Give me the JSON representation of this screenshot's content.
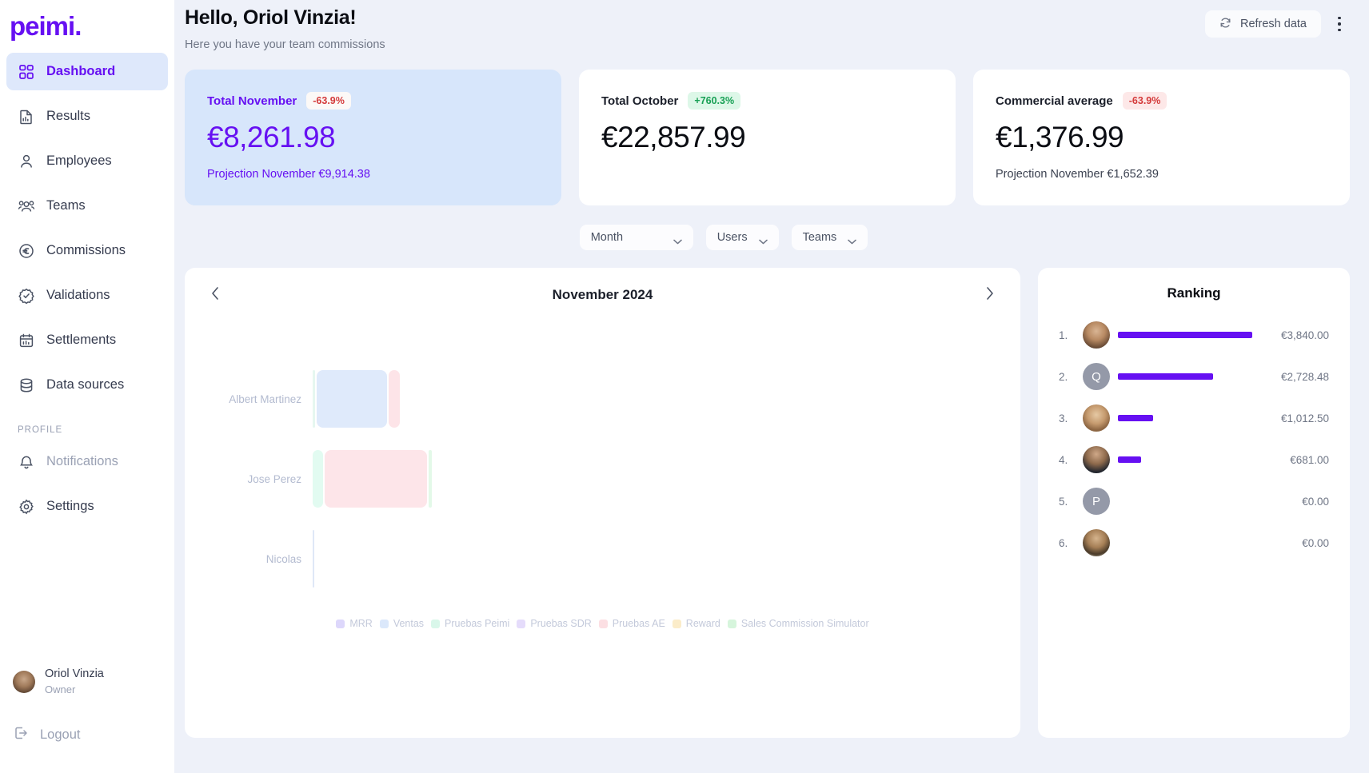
{
  "brand": {
    "name": "peimi."
  },
  "sidebar": {
    "items": [
      {
        "label": "Dashboard",
        "icon": "grid-icon",
        "active": true
      },
      {
        "label": "Results",
        "icon": "document-chart-icon",
        "active": false
      },
      {
        "label": "Employees",
        "icon": "user-icon",
        "active": false
      },
      {
        "label": "Teams",
        "icon": "users-icon",
        "active": false
      },
      {
        "label": "Commissions",
        "icon": "euro-circle-icon",
        "active": false
      },
      {
        "label": "Validations",
        "icon": "check-badge-icon",
        "active": false
      },
      {
        "label": "Settlements",
        "icon": "calendar-icon",
        "active": false
      },
      {
        "label": "Data sources",
        "icon": "database-icon",
        "active": false
      }
    ],
    "profile_section_label": "PROFILE",
    "profile_items": [
      {
        "label": "Notifications",
        "icon": "bell-icon"
      },
      {
        "label": "Settings",
        "icon": "gear-icon"
      }
    ],
    "user": {
      "name": "Oriol Vinzia",
      "role": "Owner",
      "avatar": "user-photo"
    },
    "logout": {
      "label": "Logout",
      "icon": "logout-icon"
    }
  },
  "header": {
    "title": "Hello, Oriol Vinzia!",
    "subtitle": "Here you have your team commissions",
    "refresh_label": "Refresh data",
    "refresh_icon": "refresh-icon",
    "menu_icon": "kebab-menu-icon"
  },
  "cards": [
    {
      "title": "Total November",
      "badge": "-63.9%",
      "badge_type": "neg",
      "value": "€8,261.98",
      "sub": "Projection November €9,914.38",
      "highlight": true
    },
    {
      "title": "Total October",
      "badge": "+760.3%",
      "badge_type": "pos",
      "value": "€22,857.99",
      "sub": "",
      "highlight": false
    },
    {
      "title": "Commercial average",
      "badge": "-63.9%",
      "badge_type": "neg",
      "value": "€1,376.99",
      "sub": "Projection November €1,652.39",
      "highlight": false
    }
  ],
  "filters": [
    {
      "label": "Month",
      "icon": "chevron-down-icon",
      "wide": true
    },
    {
      "label": "Users",
      "icon": "chevron-down-icon",
      "wide": false
    },
    {
      "label": "Teams",
      "icon": "chevron-down-icon",
      "wide": false
    }
  ],
  "chart_data": {
    "type": "bar",
    "orientation": "horizontal",
    "title": "November 2024",
    "prev_icon": "chevron-left-icon",
    "next_icon": "chevron-right-icon",
    "categories": [
      "Albert Martinez",
      "Jose Perez",
      "Nicolas"
    ],
    "legend_position": "bottom",
    "grid": false,
    "xlabel": "",
    "ylabel": "",
    "series": [
      {
        "name": "MRR",
        "color": "#dcd6fb",
        "values": [
          0,
          0,
          0
        ]
      },
      {
        "name": "Ventas",
        "color": "#dbe8fb",
        "values": [
          88,
          0,
          0
        ]
      },
      {
        "name": "Pruebas Peimi",
        "color": "#d9f7ea",
        "values": [
          2,
          10,
          0
        ]
      },
      {
        "name": "Pruebas SDR",
        "color": "#e5dcfb",
        "values": [
          0,
          0,
          0
        ]
      },
      {
        "name": "Pruebas AE",
        "color": "#fce0e4",
        "values": [
          10,
          87,
          0
        ]
      },
      {
        "name": "Reward",
        "color": "#fbeccd",
        "values": [
          0,
          0,
          0
        ]
      },
      {
        "name": "Sales Commission Simulator",
        "color": "#d6f5dc",
        "values": [
          0,
          3,
          0
        ]
      }
    ],
    "bars": [
      {
        "category": "Albert Martinez",
        "segments": [
          {
            "series": "Pruebas Peimi",
            "color": "#e6f7f0",
            "width": 3
          },
          {
            "series": "Ventas",
            "color": "#dfeafb",
            "width": 88
          },
          {
            "series": "Pruebas AE",
            "color": "#fde4e8",
            "width": 14
          }
        ]
      },
      {
        "category": "Jose Perez",
        "segments": [
          {
            "series": "Pruebas Peimi",
            "color": "#e2fbf1",
            "width": 13
          },
          {
            "series": "Pruebas AE",
            "color": "#fde5e9",
            "width": 128
          },
          {
            "series": "Sales Commission Simulator",
            "color": "#e3f9e8",
            "width": 4
          }
        ]
      },
      {
        "category": "Nicolas",
        "segments": [
          {
            "series": "MRR",
            "color": "#dfe8f7",
            "width": 2
          }
        ]
      }
    ]
  },
  "ranking": {
    "title": "Ranking",
    "rows": [
      {
        "position": "1.",
        "avatar_type": "photo",
        "avatar_initial": "",
        "amount": "€3,840.00",
        "bar_pct": 100
      },
      {
        "position": "2.",
        "avatar_type": "initial",
        "avatar_initial": "Q",
        "amount": "€2,728.48",
        "bar_pct": 71
      },
      {
        "position": "3.",
        "avatar_type": "photo",
        "avatar_initial": "",
        "amount": "€1,012.50",
        "bar_pct": 26
      },
      {
        "position": "4.",
        "avatar_type": "photo",
        "avatar_initial": "",
        "amount": "€681.00",
        "bar_pct": 17
      },
      {
        "position": "5.",
        "avatar_type": "initial",
        "avatar_initial": "P",
        "amount": "€0.00",
        "bar_pct": 0
      },
      {
        "position": "6.",
        "avatar_type": "photo",
        "avatar_initial": "",
        "amount": "€0.00",
        "bar_pct": 0
      }
    ]
  },
  "colors": {
    "accent": "#6610f2",
    "page_bg": "#eef1f9",
    "card_highlight_bg": "#d7e6fb",
    "positive": "#18a055",
    "negative": "#d43b3b"
  }
}
